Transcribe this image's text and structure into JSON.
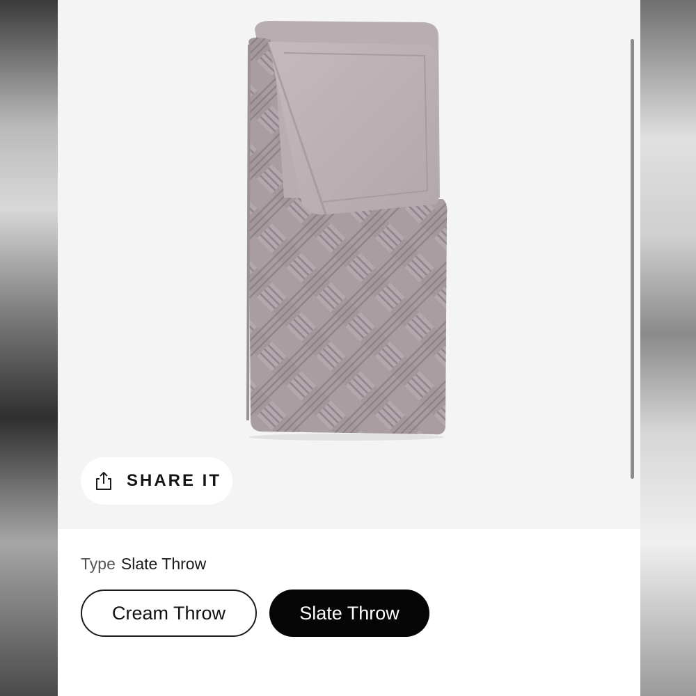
{
  "share": {
    "label": "SHARE IT",
    "icon": "share-icon"
  },
  "variant": {
    "type_label": "Type",
    "selected_value": "Slate Throw",
    "options": [
      {
        "label": "Cream Throw",
        "selected": false
      },
      {
        "label": "Slate Throw",
        "selected": true
      }
    ]
  },
  "colors": {
    "gallery_background": "#f4f4f4",
    "throw_color": "#a99da2",
    "selected_option_bg": "#050505",
    "unselected_option_border": "#1a1a1a"
  }
}
